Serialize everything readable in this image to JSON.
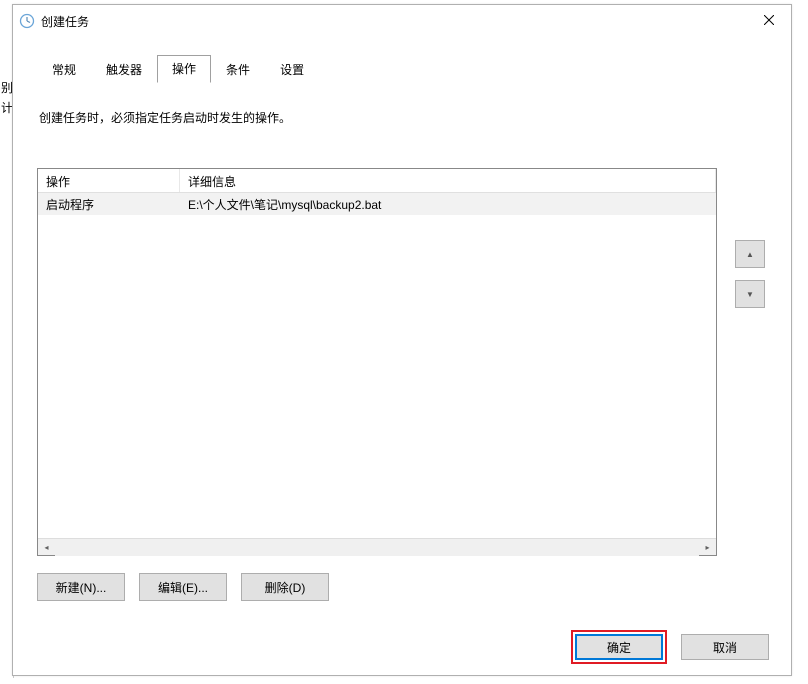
{
  "window": {
    "title": "创建任务"
  },
  "background": {
    "left_chars": "别\n计"
  },
  "tabs": {
    "items": [
      {
        "label": "常规",
        "active": false
      },
      {
        "label": "触发器",
        "active": false
      },
      {
        "label": "操作",
        "active": true
      },
      {
        "label": "条件",
        "active": false
      },
      {
        "label": "设置",
        "active": false
      }
    ]
  },
  "description": "创建任务时，必须指定任务启动时发生的操作。",
  "table": {
    "headers": {
      "action": "操作",
      "detail": "详细信息"
    },
    "rows": [
      {
        "action": "启动程序",
        "detail": "E:\\个人文件\\笔记\\mysql\\backup2.bat"
      }
    ]
  },
  "side_buttons": {
    "up": "▲",
    "down": "▼"
  },
  "actions": {
    "new": "新建(N)...",
    "edit": "编辑(E)...",
    "delete": "删除(D)"
  },
  "footer": {
    "ok": "确定",
    "cancel": "取消"
  }
}
